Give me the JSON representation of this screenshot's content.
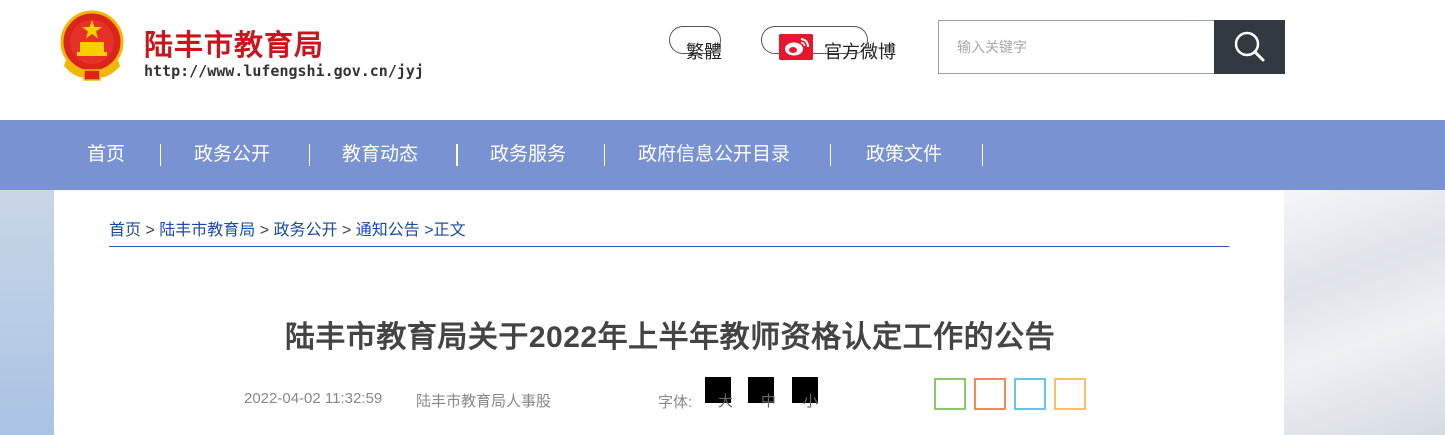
{
  "header": {
    "site_name": "陆丰市教育局",
    "site_url": "http://www.lufengshi.gov.cn/jyj",
    "traditional_label": "繁體",
    "weibo_label": "官方微博",
    "search_placeholder": "输入关键字"
  },
  "nav": {
    "items": [
      {
        "label": "首页"
      },
      {
        "label": "政务公开"
      },
      {
        "label": "教育动态"
      },
      {
        "label": "政务服务"
      },
      {
        "label": "政府信息公开目录"
      },
      {
        "label": "政策文件"
      }
    ]
  },
  "breadcrumb": {
    "items": [
      "首页",
      "陆丰市教育局",
      "政务公开",
      "通知公告"
    ],
    "separator": ">",
    "current": ">正文"
  },
  "article": {
    "title": "陆丰市教育局关于2022年上半年教师资格认定工作的公告",
    "date": "2022-04-02 11:32:59",
    "source": "陆丰市教育局人事股",
    "font_label": "字体:",
    "font_sizes": [
      "大",
      "中",
      "小"
    ]
  },
  "theme_swatches": [
    "#8cc76b",
    "#f08a5d",
    "#6cc3e8",
    "#f5c26b"
  ],
  "colors": {
    "brand_red": "#c8161d",
    "nav_bg": "#7892d2",
    "link_blue": "#1a4aa3",
    "search_btn": "#333940"
  }
}
